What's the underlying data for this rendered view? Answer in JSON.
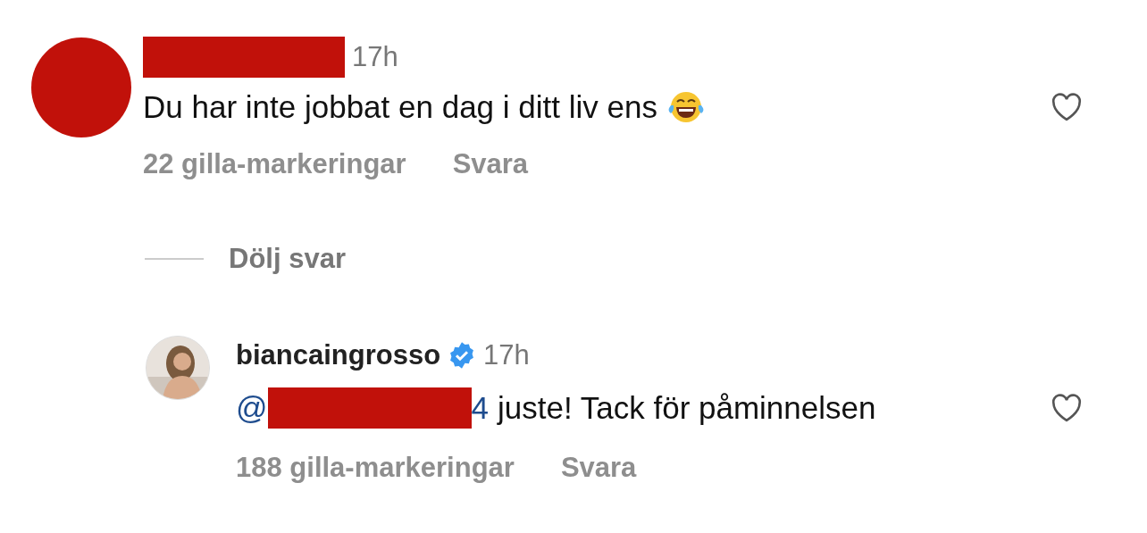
{
  "comment": {
    "avatar": {
      "kind": "redacted"
    },
    "username": {
      "kind": "redacted"
    },
    "time": "17h",
    "text": "Du har inte jobbat en dag i ditt liv ens",
    "emoji": {
      "kind": "tears-of-joy"
    },
    "likes": "22 gilla-markeringar",
    "reply_link": "Svara",
    "liked": false
  },
  "hide_replies": "Dölj svar",
  "reply": {
    "username": "biancaingrosso",
    "verified": true,
    "time": "17h",
    "mention_start": "@",
    "mention_end": "4",
    "text": "juste! Tack för påminnelsen",
    "likes": "188 gilla-markeringar",
    "reply_link": "Svara",
    "liked": false
  }
}
